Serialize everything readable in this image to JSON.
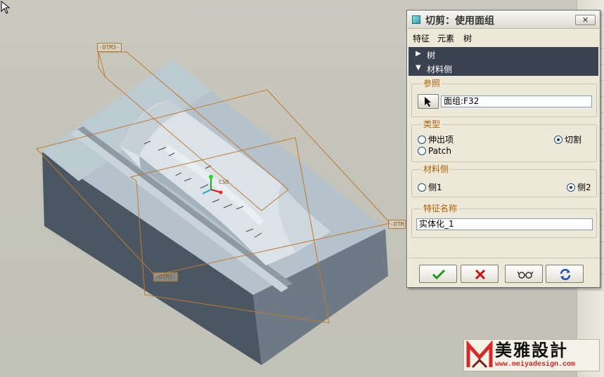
{
  "viewport": {
    "datum_top": "-DTM3-",
    "datum_right": "-DTM",
    "datum_bottom": "-DTM1-",
    "csys_label": "CSO"
  },
  "dialog": {
    "title": "切剪：使用面组",
    "close_label": "✕",
    "menu": [
      "特征",
      "元素",
      "树"
    ],
    "collapse": [
      {
        "arrow": "▶",
        "label": "树"
      },
      {
        "arrow": "▼",
        "label": "材料侧"
      }
    ],
    "reference": {
      "legend": "参照",
      "value": "面组:F32"
    },
    "type": {
      "legend": "类型",
      "options": [
        {
          "label": "伸出项",
          "selected": false
        },
        {
          "label": "切割",
          "selected": true
        },
        {
          "label": "Patch",
          "selected": false
        }
      ]
    },
    "material_side": {
      "legend": "材料侧",
      "options": [
        {
          "label": "侧1",
          "selected": false
        },
        {
          "label": "侧2",
          "selected": true
        }
      ]
    },
    "feature_name": {
      "legend": "特征名称",
      "value": "实体化_1"
    },
    "buttons": [
      "ok-check-icon",
      "cancel-x-icon",
      "preview-glasses-icon",
      "refresh-arrows-icon"
    ]
  },
  "logo": {
    "brand": "美雅設計",
    "url": "www.meiyadesign.com"
  },
  "colors": {
    "accent_orange": "#b45c00",
    "header_dark": "#3a4150",
    "ok_green": "#1a9a1a",
    "cancel_red": "#cc1111",
    "model_body": "#a9b6bf"
  }
}
